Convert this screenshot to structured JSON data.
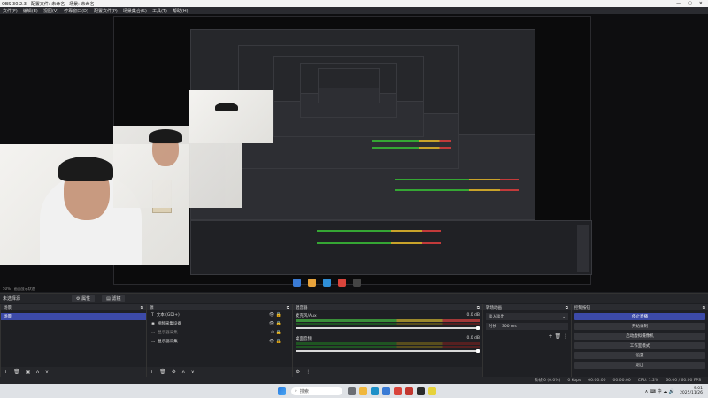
{
  "titlebar": {
    "title": "OBS 30.2.3 - 配置文件: 未命名 - 场景: 未命名",
    "winctl": [
      "—",
      "▢",
      "✕"
    ]
  },
  "menubar": [
    "文件(F)",
    "编辑(E)",
    "视图(V)",
    "停靠窗口(D)",
    "配置文件(P)",
    "场景集合(S)",
    "工具(T)",
    "帮助(H)"
  ],
  "preview_status": "50%  ·  画面显示状态",
  "toolrow": {
    "left_label": "未选择源",
    "properties_label": "属性",
    "filters_label": "滤镜"
  },
  "scenes": {
    "title": "场景",
    "items": [
      "场景"
    ]
  },
  "sources": {
    "title": "源",
    "items": [
      {
        "name": "文本 (GDI+)",
        "icon": "text-icon"
      },
      {
        "name": "视频采集设备",
        "icon": "camera-icon"
      },
      {
        "name": "显示器采集",
        "icon": "monitor-icon"
      },
      {
        "name": "显示器采集",
        "icon": "monitor-icon"
      }
    ]
  },
  "mixer": {
    "title": "混音器",
    "channels": [
      {
        "name": "麦克风/Aux",
        "db": "0.0 dB"
      },
      {
        "name": "桌面音频",
        "db": "0.0 dB"
      }
    ]
  },
  "transitions": {
    "title": "转场动画",
    "type": "淡入淡出",
    "duration_label": "时长",
    "duration": "300 ms"
  },
  "controls": {
    "title": "控制按钮",
    "buttons": [
      "停止直播",
      "开始录制",
      "启动虚拟摄像机",
      "工作室模式",
      "设置",
      "退出"
    ]
  },
  "statusbar": {
    "dropped": "丢帧 0 (0.0%)",
    "bitrate": "0 kbps",
    "rec": "00:00:00",
    "live": "00:00:00",
    "cpu": "CPU: 1.2%",
    "fps": "60.00 / 60.00 FPS"
  },
  "taskbar": {
    "search_placeholder": "搜索",
    "time": "9:01",
    "date": "2025/11/26"
  },
  "colors": {
    "accent": "#3c4aa8",
    "meter_green": "#3d9a3b",
    "meter_yellow": "#a9932d",
    "meter_red": "#b03a3a"
  }
}
